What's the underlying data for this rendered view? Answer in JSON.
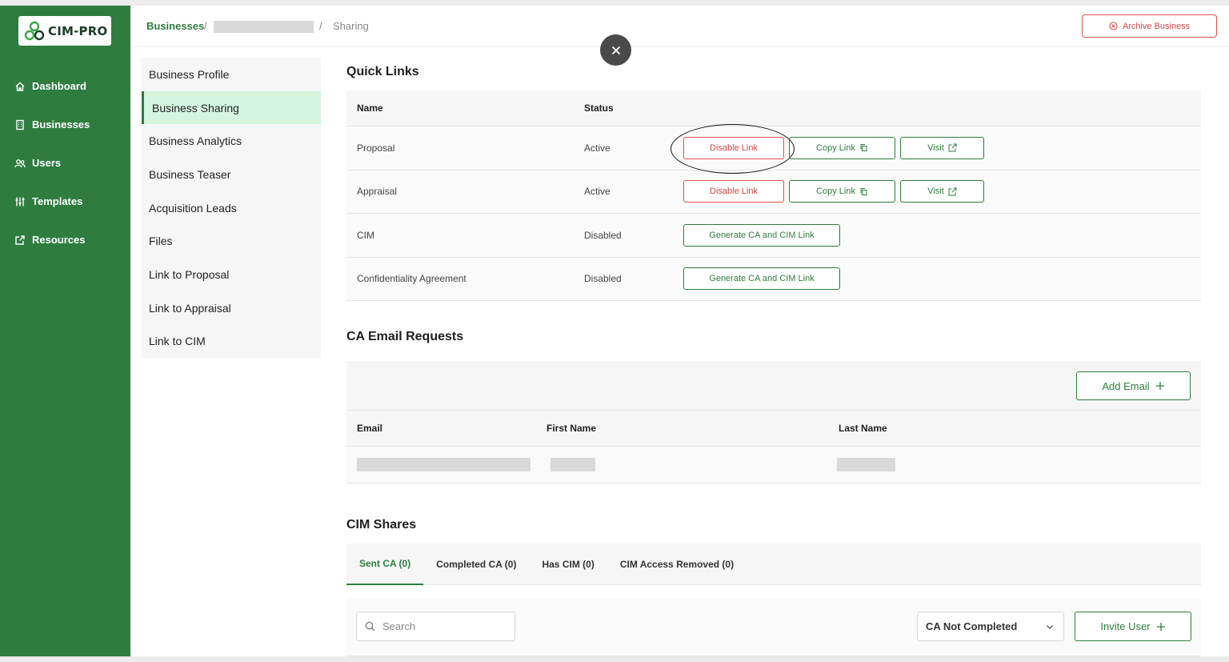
{
  "app": {
    "logo_text": "CIM-PRO"
  },
  "sidebar": {
    "items": [
      {
        "label": "Dashboard",
        "icon": "home-icon"
      },
      {
        "label": "Businesses",
        "icon": "building-icon"
      },
      {
        "label": "Users",
        "icon": "users-icon"
      },
      {
        "label": "Templates",
        "icon": "sliders-icon"
      },
      {
        "label": "Resources",
        "icon": "external-link-icon"
      }
    ]
  },
  "breadcrumb": {
    "root": "Businesses",
    "sep": "/",
    "current": "Sharing"
  },
  "header": {
    "archive_label": "Archive Business"
  },
  "subnav": {
    "items": [
      "Business Profile",
      "Business Sharing",
      "Business Analytics",
      "Business Teaser",
      "Acquisition Leads",
      "Files",
      "Link to Proposal",
      "Link to Appraisal",
      "Link to CIM"
    ],
    "active_index": 1
  },
  "quick_links": {
    "title": "Quick Links",
    "headers": {
      "name": "Name",
      "status": "Status"
    },
    "rows": [
      {
        "name": "Proposal",
        "status": "Active",
        "disable": "Disable Link",
        "copy": "Copy Link",
        "visit": "Visit"
      },
      {
        "name": "Appraisal",
        "status": "Active",
        "disable": "Disable Link",
        "copy": "Copy Link",
        "visit": "Visit"
      },
      {
        "name": "CIM",
        "status": "Disabled",
        "generate": "Generate CA and CIM Link"
      },
      {
        "name": "Confidentiality Agreement",
        "status": "Disabled",
        "generate": "Generate CA and CIM Link"
      }
    ]
  },
  "ca_requests": {
    "title": "CA Email Requests",
    "add_email": "Add Email",
    "headers": {
      "email": "Email",
      "first_name": "First Name",
      "last_name": "Last Name"
    }
  },
  "cim_shares": {
    "title": "CIM Shares",
    "tabs": [
      "Sent CA (0)",
      "Completed CA (0)",
      "Has CIM (0)",
      "CIM Access Removed (0)"
    ],
    "active_tab": 0,
    "search_placeholder": "Search",
    "filter_value": "CA Not Completed",
    "invite_label": "Invite User"
  },
  "colors": {
    "brand_green": "#2e7d3f",
    "danger_red": "#d64545",
    "active_tab_bg": "#d4f5de"
  }
}
